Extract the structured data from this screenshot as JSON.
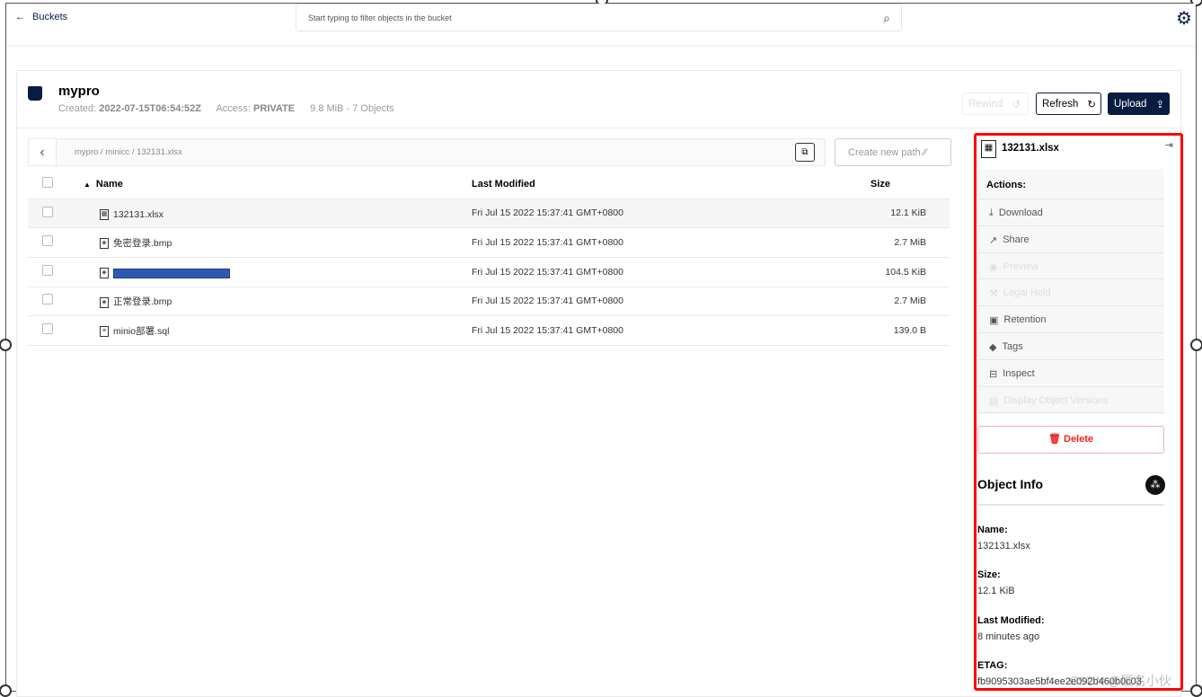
{
  "topbar": {
    "back_label": "Buckets",
    "search_placeholder": "Start typing to filter objects in the bucket"
  },
  "bucket": {
    "name": "mypro",
    "created_label": "Created:",
    "created": "2022-07-15T06:54:52Z",
    "access_label": "Access:",
    "access": "PRIVATE",
    "summary": "9.8 MiB - 7 Objects"
  },
  "toolbar": {
    "rewind": "Rewind",
    "refresh": "Refresh",
    "upload": "Upload",
    "create_path": "Create new path"
  },
  "breadcrumb": "mypro / minicc / 132131.xlsx",
  "table": {
    "headers": [
      "Name",
      "Last Modified",
      "Size"
    ],
    "rows": [
      {
        "name": "132131.xlsx",
        "modified": "Fri Jul 15 2022 15:37:41 GMT+0800",
        "size": "12.1 KiB",
        "icon": "spreadsheet-icon"
      },
      {
        "name": "免密登录.bmp",
        "modified": "Fri Jul 15 2022 15:37:41 GMT+0800",
        "size": "2.7 MiB",
        "icon": "image-icon"
      },
      {
        "name": "",
        "modified": "Fri Jul 15 2022 15:37:41 GMT+0800",
        "size": "104.5 KiB",
        "icon": "image-icon"
      },
      {
        "name": "正常登录.bmp",
        "modified": "Fri Jul 15 2022 15:37:41 GMT+0800",
        "size": "2.7 MiB",
        "icon": "image-icon"
      },
      {
        "name": "minio部署.sql",
        "modified": "Fri Jul 15 2022 15:37:41 GMT+0800",
        "size": "139.0 B",
        "icon": "document-icon"
      }
    ]
  },
  "details": {
    "filename": "132131.xlsx",
    "actions_title": "Actions:",
    "actions": [
      {
        "label": "Download",
        "enabled": true
      },
      {
        "label": "Share",
        "enabled": true
      },
      {
        "label": "Preview",
        "enabled": false
      },
      {
        "label": "Legal Hold",
        "enabled": false
      },
      {
        "label": "Retention",
        "enabled": true
      },
      {
        "label": "Tags",
        "enabled": true
      },
      {
        "label": "Inspect",
        "enabled": true
      },
      {
        "label": "Display Object Versions",
        "enabled": false
      }
    ],
    "delete": "Delete",
    "info_title": "Object Info",
    "name_label": "Name:",
    "name": "132131.xlsx",
    "size_label": "Size:",
    "size": "12.1 KiB",
    "modified_label": "Last Modified:",
    "modified": "8 minutes ago",
    "etag_label": "ETAG:",
    "etag": "fb9095303ae5bf4ee2e092b460b0c03"
  },
  "watermark": "CSDN @匿名小伙"
}
